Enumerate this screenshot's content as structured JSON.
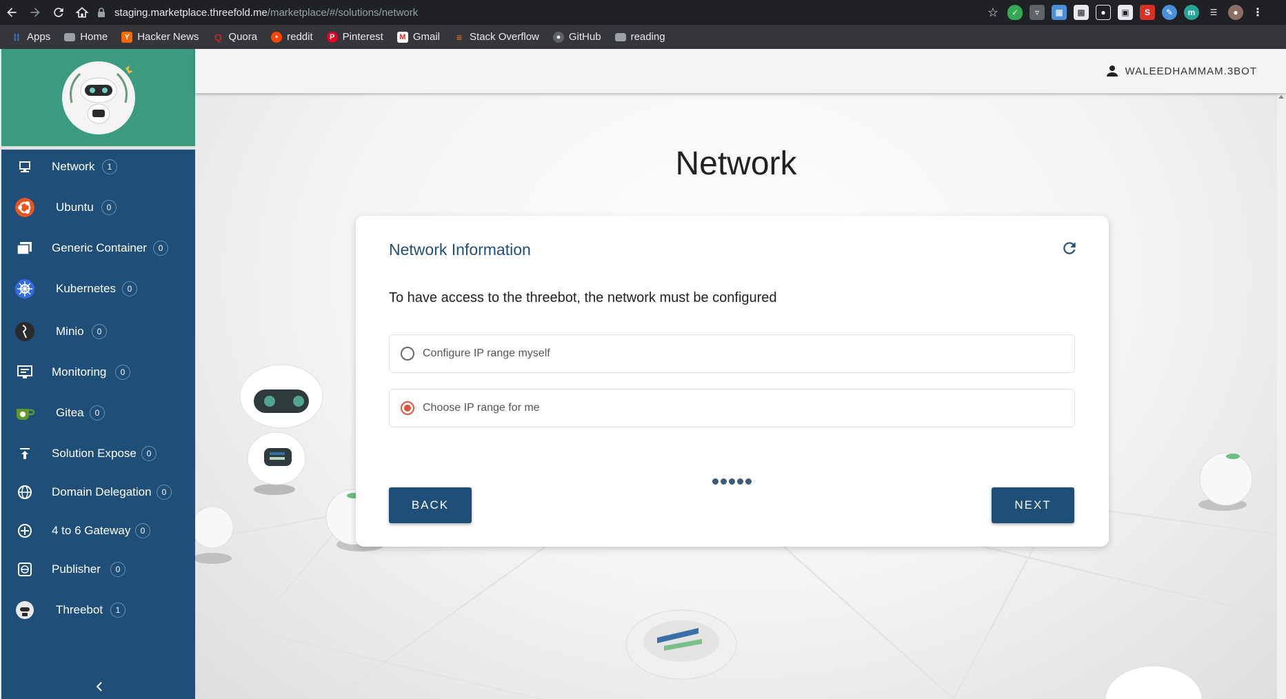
{
  "browser": {
    "url_host": "staging.marketplace.threefold.me",
    "url_path": "/marketplace/#/solutions/network",
    "bookmarks": [
      {
        "label": "Apps",
        "icon": "apps-grid-icon",
        "color": "#4285f4"
      },
      {
        "label": "Home",
        "icon": "folder-icon",
        "color": "#9aa0a6"
      },
      {
        "label": "Hacker News",
        "icon": "hacker-news-icon",
        "color": "#ff6600"
      },
      {
        "label": "Quora",
        "icon": "quora-icon",
        "color": "#b92b27"
      },
      {
        "label": "reddit",
        "icon": "reddit-icon",
        "color": "#ff4500"
      },
      {
        "label": "Pinterest",
        "icon": "pinterest-icon",
        "color": "#e60023"
      },
      {
        "label": "Gmail",
        "icon": "gmail-icon",
        "color": "#d93025"
      },
      {
        "label": "Stack Overflow",
        "icon": "stack-overflow-icon",
        "color": "#f48024"
      },
      {
        "label": "GitHub",
        "icon": "github-icon",
        "color": "#5f6368"
      },
      {
        "label": "reading",
        "icon": "folder-icon",
        "color": "#9aa0a6"
      }
    ]
  },
  "header": {
    "username": "WALEEDHAMMAM.3BOT"
  },
  "sidebar": {
    "items": [
      {
        "label": "Network",
        "count": "1",
        "icon": "network-icon"
      },
      {
        "label": "Ubuntu",
        "count": "0",
        "icon": "ubuntu-icon"
      },
      {
        "label": "Generic Container",
        "count": "0",
        "icon": "container-icon"
      },
      {
        "label": "Kubernetes",
        "count": "0",
        "icon": "kubernetes-icon"
      },
      {
        "label": "Minio",
        "count": "0",
        "icon": "minio-icon"
      },
      {
        "label": "Monitoring",
        "count": "0",
        "icon": "monitoring-icon"
      },
      {
        "label": "Gitea",
        "count": "0",
        "icon": "gitea-icon"
      },
      {
        "label": "Solution Expose",
        "count": "0",
        "icon": "expose-icon"
      },
      {
        "label": "Domain Delegation",
        "count": "0",
        "icon": "globe-icon"
      },
      {
        "label": "4 to 6 Gateway",
        "count": "0",
        "icon": "gateway-icon"
      },
      {
        "label": "Publisher",
        "count": "0",
        "icon": "publisher-icon"
      },
      {
        "label": "Threebot",
        "count": "1",
        "icon": "threebot-icon"
      }
    ]
  },
  "page": {
    "title": "Network",
    "card_title": "Network Information",
    "description": "To have access to the threebot, the network must be configured",
    "options": [
      {
        "label": "Configure IP range myself",
        "selected": false
      },
      {
        "label": "Choose IP range for me",
        "selected": true
      }
    ],
    "back_label": "BACK",
    "next_label": "NEXT"
  },
  "colors": {
    "sidebar_bg": "#1f4e79",
    "logo_bg": "#3b9b7e",
    "accent": "#1f4e79",
    "radio_selected": "#e0533a"
  }
}
